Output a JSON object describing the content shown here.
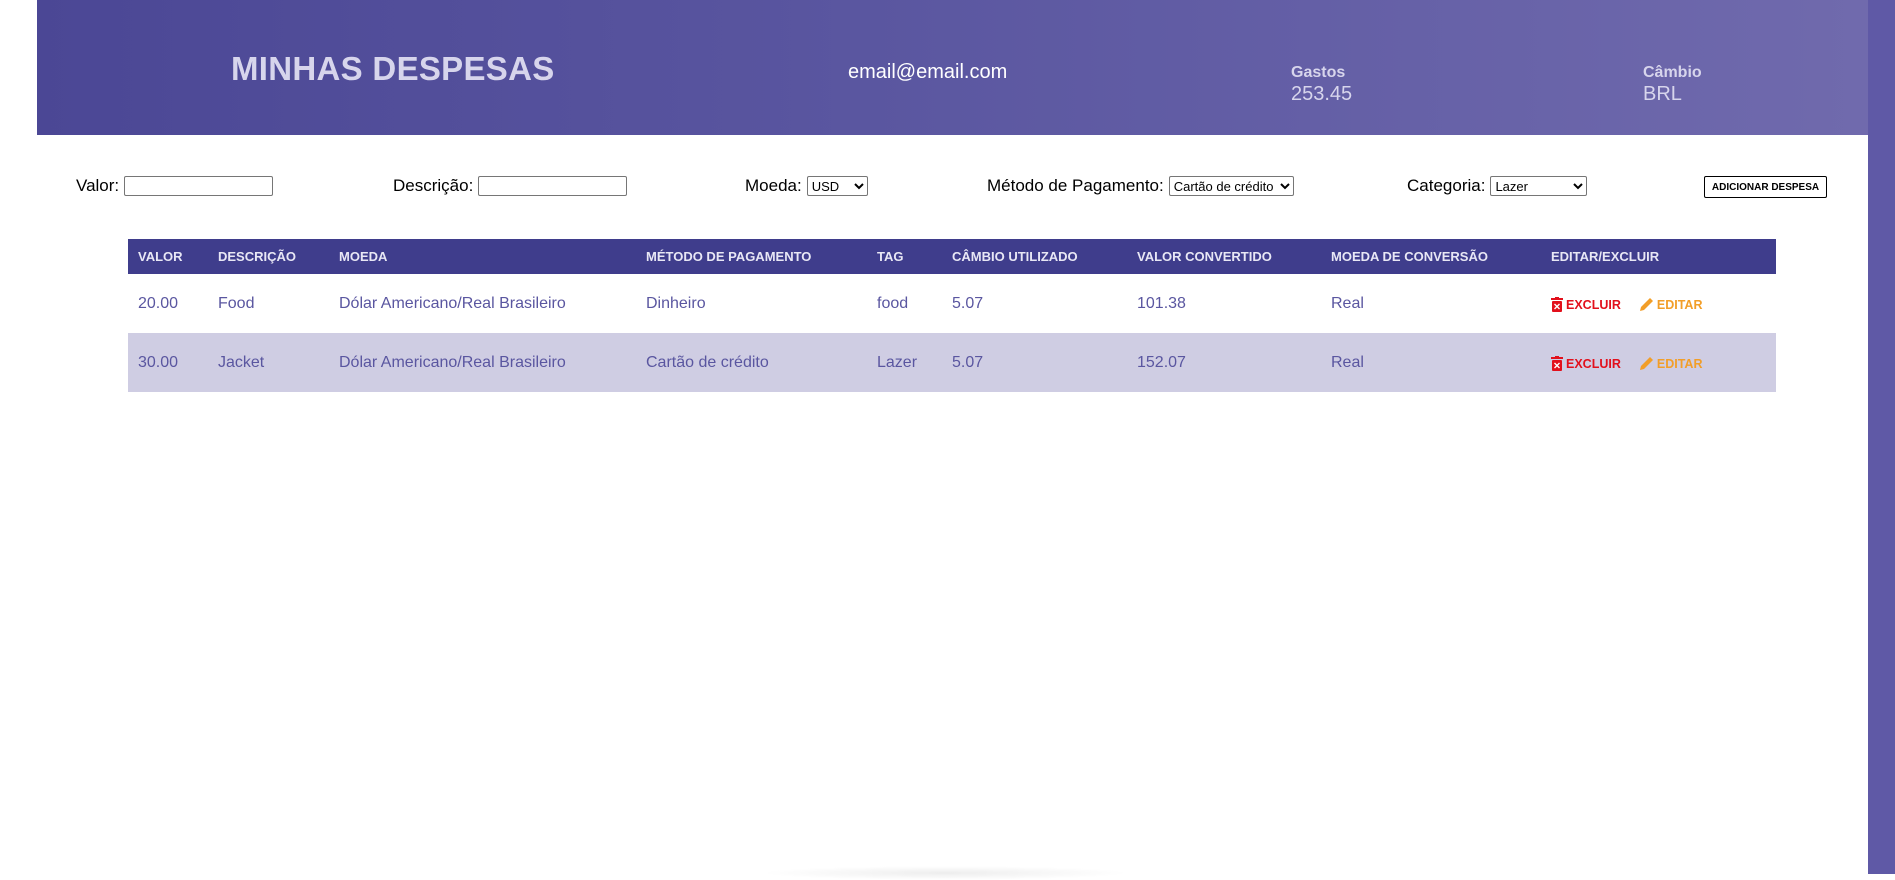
{
  "header": {
    "title": "MINHAS DESPESAS",
    "email": "email@email.com",
    "gastos_label": "Gastos",
    "gastos_value": "253.45",
    "cambio_label": "Câmbio",
    "cambio_value": "BRL"
  },
  "form": {
    "valor_label": "Valor:",
    "valor_value": "",
    "descricao_label": "Descrição:",
    "descricao_value": "",
    "moeda_label": "Moeda:",
    "moeda_selected": "USD",
    "metodo_label": "Método de Pagamento:",
    "metodo_selected": "Cartão de crédito",
    "categoria_label": "Categoria:",
    "categoria_selected": "Lazer",
    "add_button": "ADICIONAR DESPESA"
  },
  "table": {
    "headers": [
      "VALOR",
      "DESCRIÇÃO",
      "MOEDA",
      "MÉTODO DE PAGAMENTO",
      "TAG",
      "CÂMBIO UTILIZADO",
      "VALOR CONVERTIDO",
      "MOEDA DE CONVERSÃO",
      "EDITAR/EXCLUIR"
    ],
    "rows": [
      {
        "valor": "20.00",
        "descricao": "Food",
        "moeda": "Dólar Americano/Real Brasileiro",
        "metodo": "Dinheiro",
        "tag": "food",
        "cambio": "5.07",
        "convertido": "101.38",
        "moeda_conversao": "Real",
        "excluir": "EXCLUIR",
        "editar": "EDITAR"
      },
      {
        "valor": "30.00",
        "descricao": "Jacket",
        "moeda": "Dólar Americano/Real Brasileiro",
        "metodo": "Cartão de crédito",
        "tag": "Lazer",
        "cambio": "5.07",
        "convertido": "152.07",
        "moeda_conversao": "Real",
        "excluir": "EXCLUIR",
        "editar": "EDITAR"
      }
    ]
  },
  "colors": {
    "header_gradient_start": "#4b4795",
    "header_gradient_end": "#706aad",
    "table_header": "#3f3d8c",
    "row_alt": "#cfcde3",
    "text_accent": "#5a56a0",
    "delete": "#e2101c",
    "edit": "#f29e28"
  },
  "icons": {
    "delete": "trash-icon",
    "edit": "pencil-icon"
  }
}
